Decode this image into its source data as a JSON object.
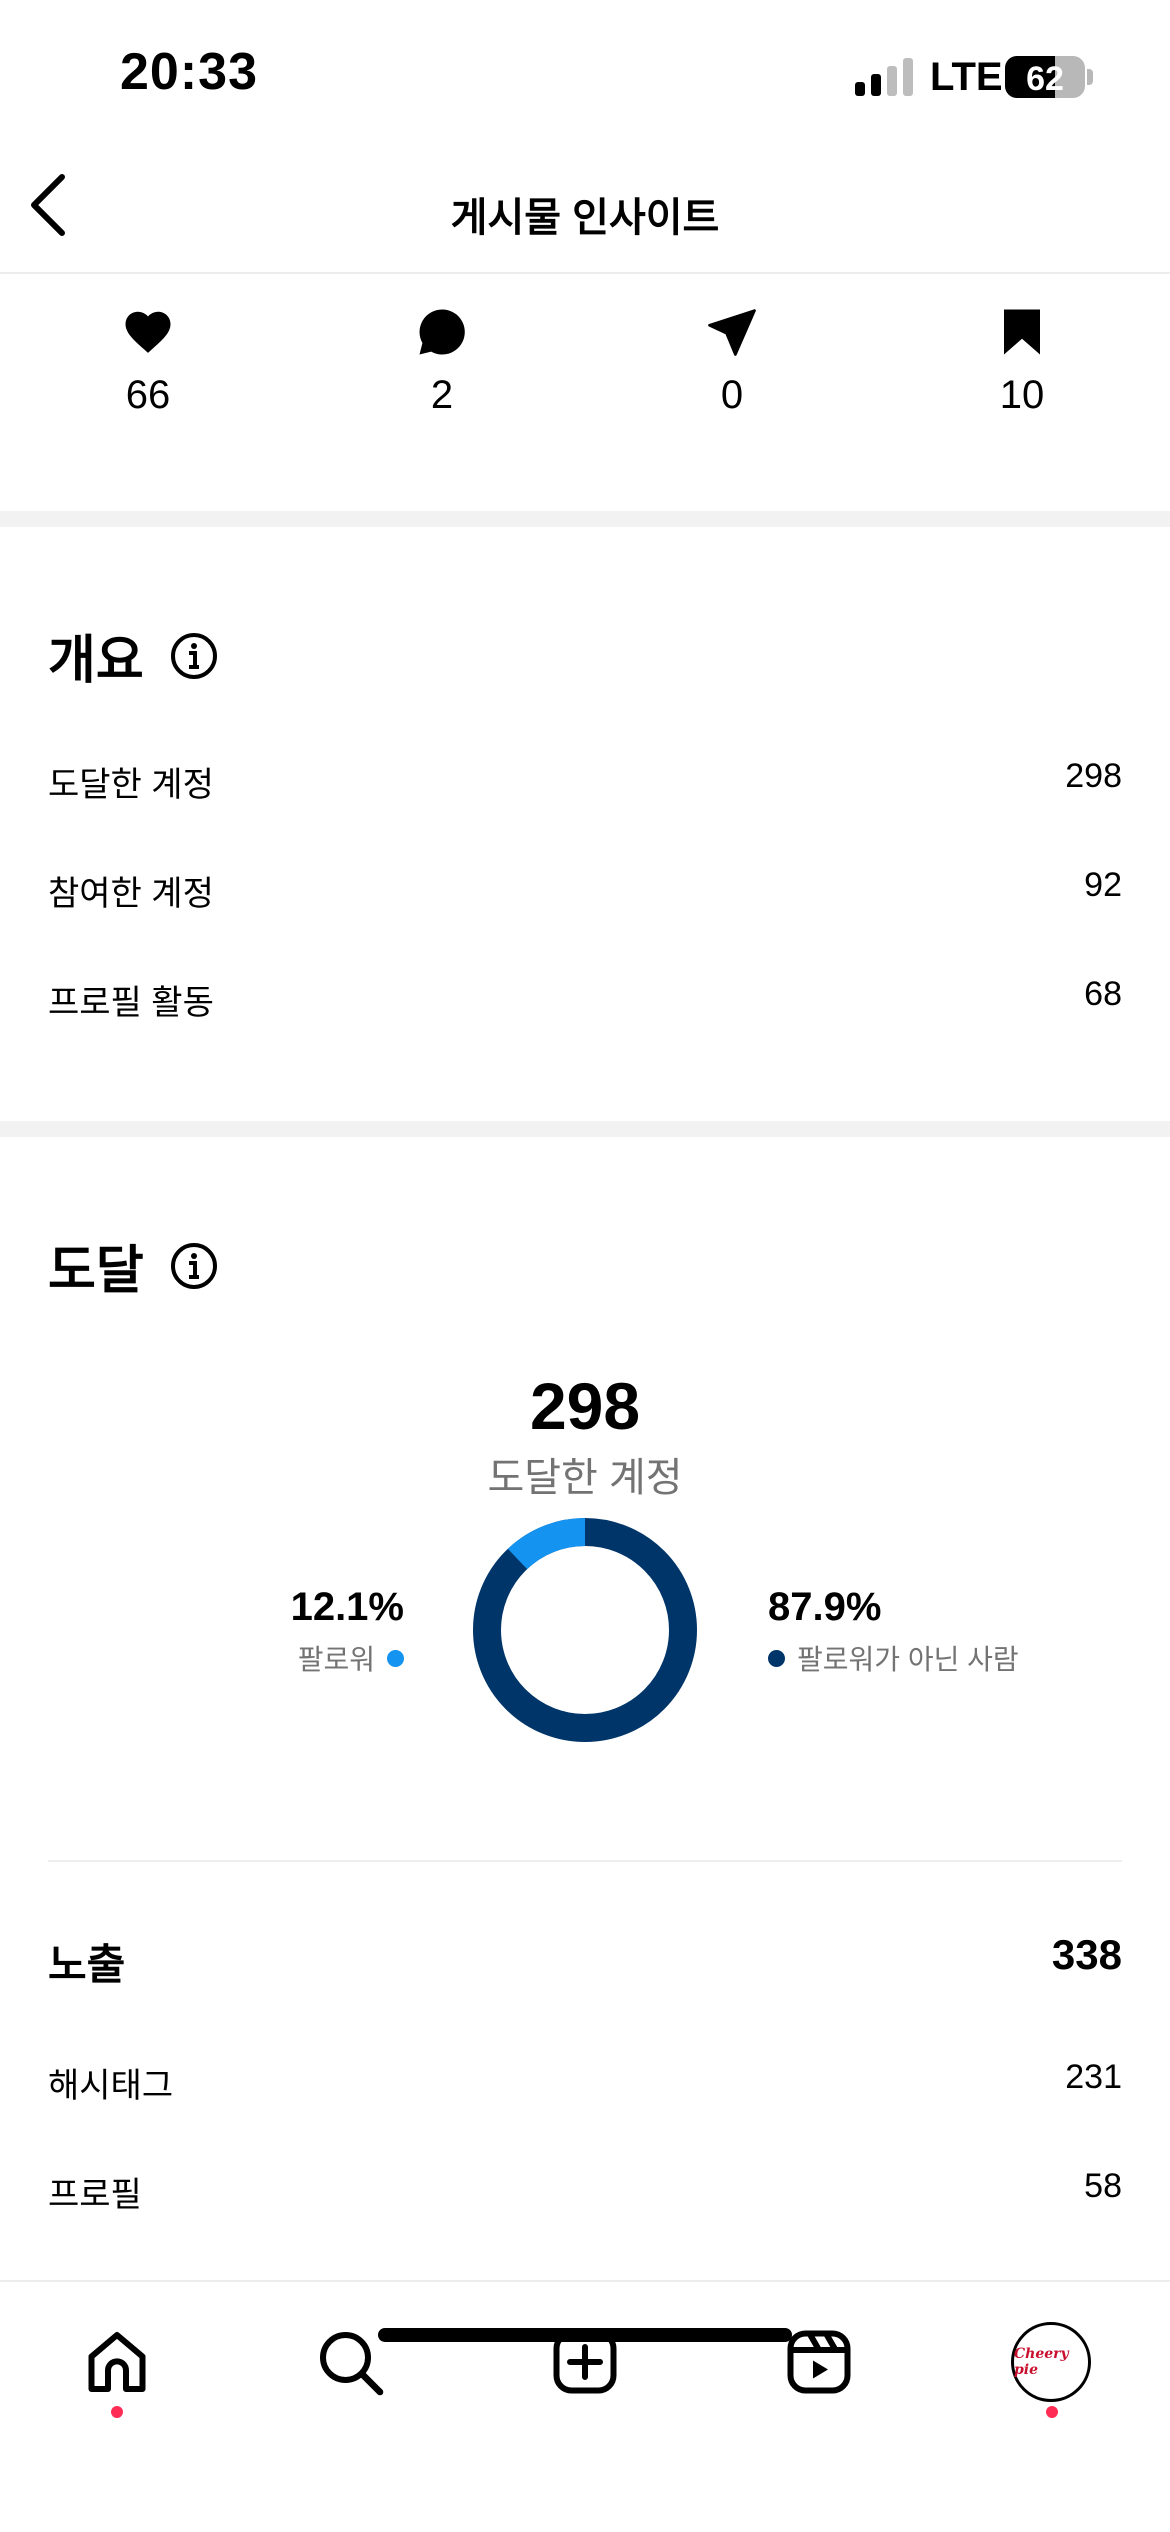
{
  "status_bar": {
    "time": "20:33",
    "network": "LTE",
    "battery": "62",
    "battery_level": 0.62
  },
  "header": {
    "title": "게시물 인사이트"
  },
  "stats": {
    "likes": "66",
    "comments": "2",
    "shares": "0",
    "saves": "10"
  },
  "overview": {
    "title": "개요",
    "rows": [
      {
        "label": "도달한 계정",
        "value": "298"
      },
      {
        "label": "참여한 계정",
        "value": "92"
      },
      {
        "label": "프로필 활동",
        "value": "68"
      }
    ]
  },
  "reach": {
    "title": "도달",
    "total": "298",
    "total_label": "도달한 계정",
    "followers_pct": "12.1%",
    "followers_label": "팔로워",
    "nonfollowers_pct": "87.9%",
    "nonfollowers_label": "팔로워가 아닌 사람",
    "followers_fraction": 0.121,
    "colors": {
      "followers": "#1493f0",
      "nonfollowers": "#003569"
    }
  },
  "impressions": {
    "title": "노출",
    "total": "338",
    "rows": [
      {
        "label": "해시태그",
        "value": "231"
      },
      {
        "label": "프로필",
        "value": "58"
      }
    ]
  },
  "nav": {
    "items": [
      "home-icon",
      "search-icon",
      "create-icon",
      "reels-icon",
      "profile-avatar"
    ],
    "avatar_text": "Cheery pie",
    "badge_color": "#ff2d55"
  }
}
